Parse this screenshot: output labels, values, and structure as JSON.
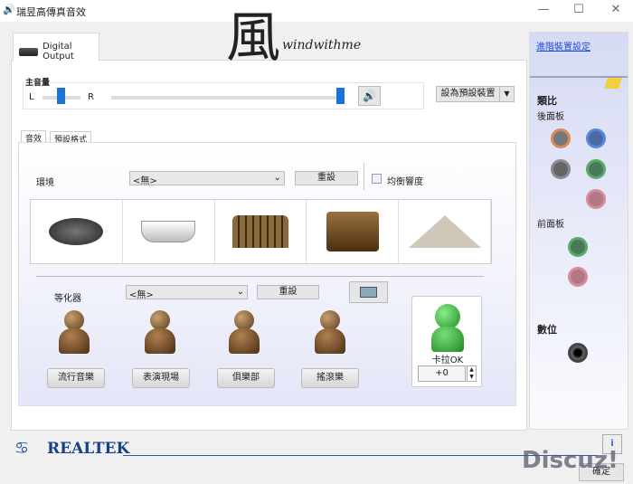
{
  "window": {
    "title": "瑞昱高傳真音效",
    "minimize": "—",
    "maximize": "☐",
    "close": "✕"
  },
  "device_tab": {
    "label": "Digital Output"
  },
  "watermark": {
    "glyph": "風",
    "text": "windwithme"
  },
  "volume": {
    "label": "主音量",
    "left": "L",
    "right": "R",
    "balance": 0.5,
    "level": 1.0
  },
  "set_default_button": "設為預設裝置",
  "inner_tabs": [
    {
      "label": "音效"
    },
    {
      "label": "預設格式"
    }
  ],
  "environment": {
    "label": "環境",
    "selected": "<無>",
    "reset": "重設",
    "equalize_label": "均衡響度",
    "equalize_checked": false,
    "presets": [
      "stone",
      "bathtub",
      "colosseum",
      "stage",
      "opera-house"
    ]
  },
  "equalizer": {
    "label": "等化器",
    "selected": "<無>",
    "reset": "重設",
    "presets": [
      {
        "label": "流行音樂"
      },
      {
        "label": "表演現場"
      },
      {
        "label": "俱樂部"
      },
      {
        "label": "搖滾樂"
      }
    ]
  },
  "karaoke": {
    "label": "卡拉OK",
    "value": "+0"
  },
  "side": {
    "advanced_link": "進階裝置設定",
    "analog": "類比",
    "rear_panel": "後面板",
    "front_panel": "前面板",
    "digital": "數位",
    "rear_jacks": [
      "#d98a5a",
      "#5a88d8",
      "#6a6a70",
      "#5aa86a",
      "#d88a98"
    ],
    "front_jacks": [
      "#5aa86a",
      "#d88a98"
    ]
  },
  "footer": {
    "brand": "REALTEK",
    "ok": "確定",
    "forum_watermark": "Discuz!"
  }
}
